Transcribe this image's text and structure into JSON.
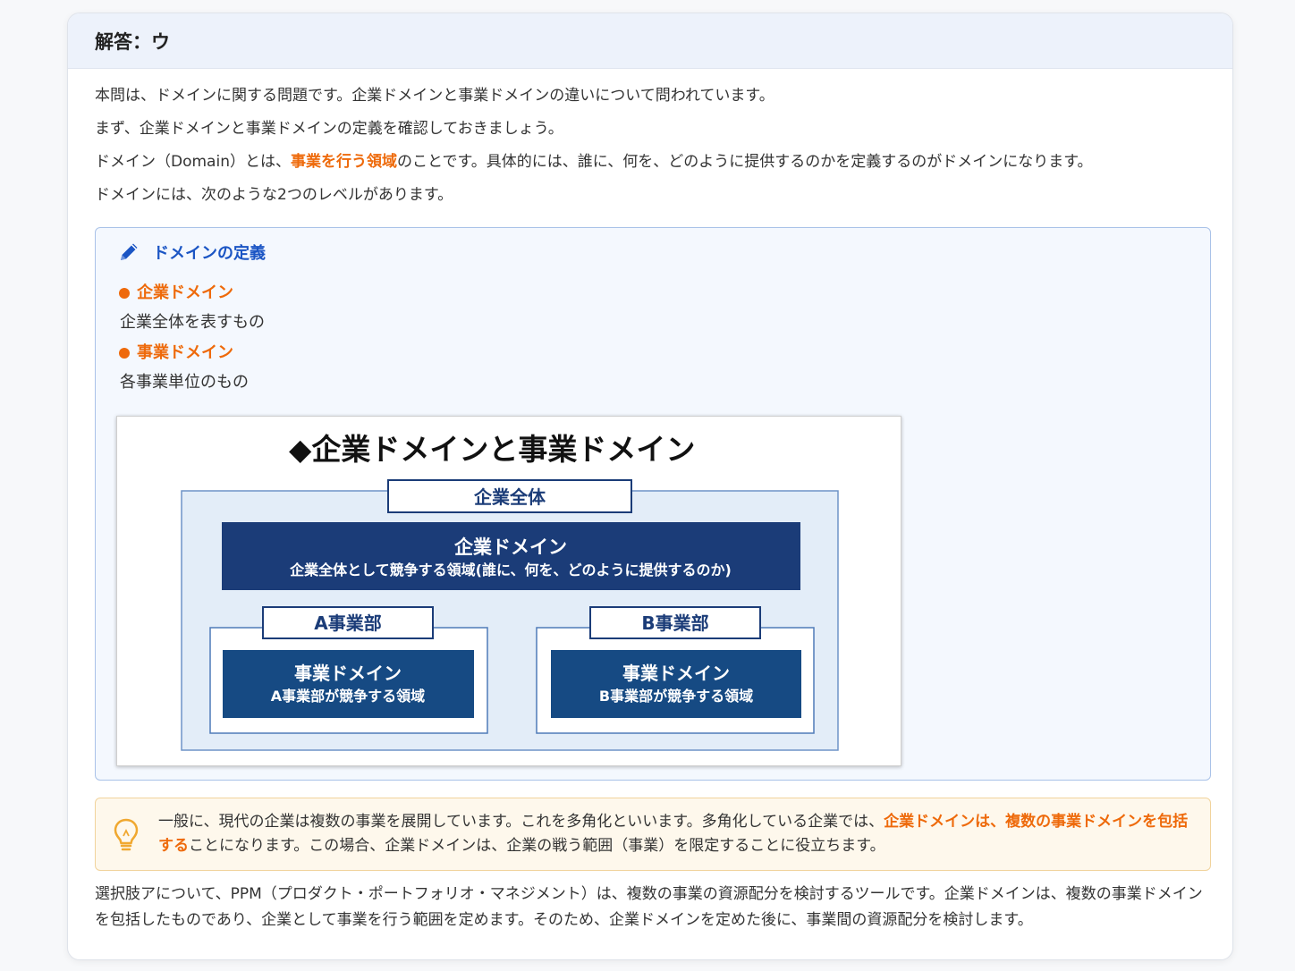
{
  "header": {
    "title": "解答：ウ"
  },
  "intro": {
    "p1": "本問は、ドメインに関する問題です。企業ドメインと事業ドメインの違いについて問われています。",
    "p2": "まず、企業ドメインと事業ドメインの定義を確認しておきましょう。",
    "p3_before": "ドメイン（Domain）とは、",
    "p3_highlight": "事業を行う領域",
    "p3_after": "のことです。具体的には、誰に、何を、どのように提供するのかを定義するのがドメインになります。",
    "p4": "ドメインには、次のような2つのレベルがあります。"
  },
  "definition": {
    "title": "ドメインの定義",
    "items": [
      {
        "label": "企業ドメイン",
        "desc": "企業全体を表すもの"
      },
      {
        "label": "事業ドメイン",
        "desc": "各事業単位のもの"
      }
    ]
  },
  "diagram": {
    "title": "◆企業ドメインと事業ドメイン",
    "outer_label": "企業全体",
    "corporate_title": "企業ドメイン",
    "corporate_desc": "企業全体として競争する領域(誰に、何を、どのように提供するのか)",
    "divisions": [
      {
        "label": "A事業部",
        "title": "事業ドメイン",
        "desc": "A事業部が競争する領域"
      },
      {
        "label": "B事業部",
        "title": "事業ドメイン",
        "desc": "B事業部が競争する領域"
      }
    ],
    "colors": {
      "navy": "#1b3c78",
      "blue": "#164a83",
      "frame": "#4f7bb8",
      "panel": "#e3edf8"
    }
  },
  "tip": {
    "before": "一般に、現代の企業は複数の事業を展開しています。これを多角化といいます。多角化している企業では、",
    "highlight": "企業ドメインは、複数の事業ドメインを包括する",
    "after": "ことになります。この場合、企業ドメインは、企業の戦う範囲（事業）を限定することに役立ちます。"
  },
  "closing": "選択肢アについて、PPM（プロダクト・ポートフォリオ・マネジメント）は、複数の事業の資源配分を検討するツールです。企業ドメインは、複数の事業ドメインを包括したものであり、企業として事業を行う範囲を定めます。そのため、企業ドメインを定めた後に、事業間の資源配分を検討します。",
  "icons": {
    "title_icon": "pencil-icon",
    "tip_icon": "lightbulb-icon"
  },
  "accent": {
    "orange": "#ee6a0b",
    "blue": "#1b55c4"
  }
}
